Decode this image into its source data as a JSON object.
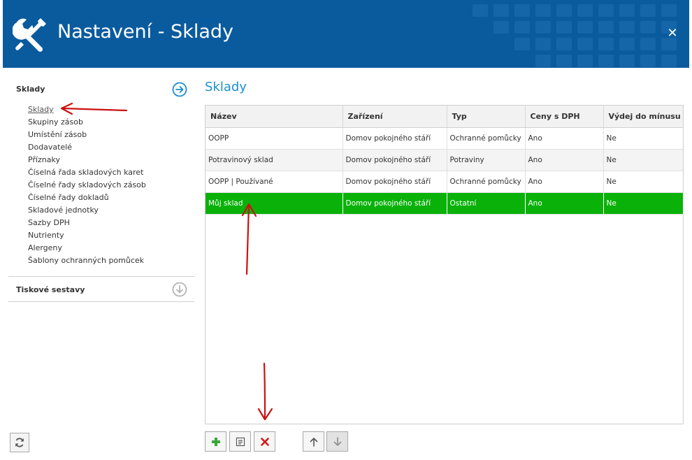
{
  "window": {
    "title": "Nastavení - Sklady"
  },
  "sidebar": {
    "section_title": "Sklady",
    "items": [
      {
        "label": "Sklady"
      },
      {
        "label": "Skupiny zásob"
      },
      {
        "label": "Umístění zásob"
      },
      {
        "label": "Dodavatelé"
      },
      {
        "label": "Příznaky"
      },
      {
        "label": "Číselná řada skladových karet"
      },
      {
        "label": "Číselné řady skladových zásob"
      },
      {
        "label": "Číselné řady dokladů"
      },
      {
        "label": "Skladové jednotky"
      },
      {
        "label": "Sazby DPH"
      },
      {
        "label": "Nutrienty"
      },
      {
        "label": "Alergeny"
      },
      {
        "label": "Šablony ochranných pomůcek"
      }
    ],
    "section2_title": "Tiskové sestavy"
  },
  "main": {
    "title": "Sklady",
    "table": {
      "columns": [
        "Název",
        "Zařízení",
        "Typ",
        "Ceny s DPH",
        "Výdej do mínusu"
      ],
      "rows": [
        [
          "OOPP",
          "Domov pokojného stáří",
          "Ochranné pomůcky",
          "Ano",
          "Ne"
        ],
        [
          "Potravinový sklad",
          "Domov pokojného stáří",
          "Potraviny",
          "Ano",
          "Ne"
        ],
        [
          "OOPP | Používané",
          "Domov pokojného stáří",
          "Ochranné pomůcky",
          "Ano",
          "Ne"
        ],
        [
          "Můj sklad",
          "Domov pokojného stáří",
          "Ostatní",
          "Ano",
          "Ne"
        ]
      ],
      "selected_row": 3
    }
  },
  "icons": {
    "window": "wrench-screwdriver-icon",
    "close": "close-icon",
    "expand": "arrow-right-circle-icon",
    "collapse": "arrow-down-circle-icon",
    "refresh": "refresh-icon",
    "add": "plus-icon",
    "edit": "edit-icon",
    "delete": "delete-icon",
    "up": "arrow-up-icon",
    "down": "arrow-down-icon"
  },
  "colors": {
    "titlebar": "#0a5b9e",
    "accent": "#1a8fd1",
    "selected_row": "#09b109",
    "add": "#3aa63a",
    "delete": "#d11a1a",
    "annotation": "#cc1111"
  }
}
